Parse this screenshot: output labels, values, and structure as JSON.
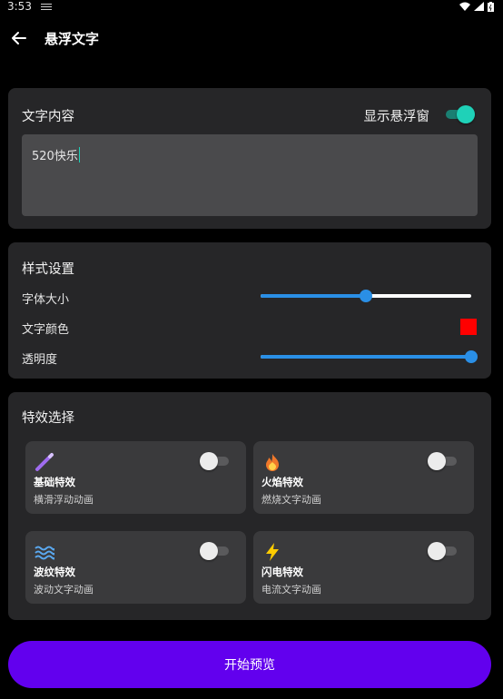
{
  "status_bar": {
    "time": "3:53"
  },
  "app_bar": {
    "title": "悬浮文字"
  },
  "text_card": {
    "title": "文字内容",
    "float_toggle_label": "显示悬浮窗",
    "float_toggle_on": true,
    "text_value": "520快乐"
  },
  "style_card": {
    "title": "样式设置",
    "font_size_label": "字体大小",
    "font_size_fraction": 0.5,
    "text_color_label": "文字颜色",
    "text_color": "#ff0000",
    "opacity_label": "透明度",
    "opacity_fraction": 1.0
  },
  "effects_card": {
    "title": "特效选择",
    "items": [
      {
        "name": "基础特效",
        "desc": "横滑浮动动画",
        "icon": "magic-wand-icon",
        "on": false
      },
      {
        "name": "火焰特效",
        "desc": "燃烧文字动画",
        "icon": "fire-icon",
        "on": false
      },
      {
        "name": "波纹特效",
        "desc": "波动文字动画",
        "icon": "waves-icon",
        "on": false
      },
      {
        "name": "闪电特效",
        "desc": "电流文字动画",
        "icon": "lightning-icon",
        "on": false
      }
    ]
  },
  "start_button": {
    "label": "开始预览"
  },
  "colors": {
    "accent": "#1fd1b8",
    "slider": "#2a8fe6",
    "primary_button": "#6200ee",
    "card_bg": "#262628"
  }
}
